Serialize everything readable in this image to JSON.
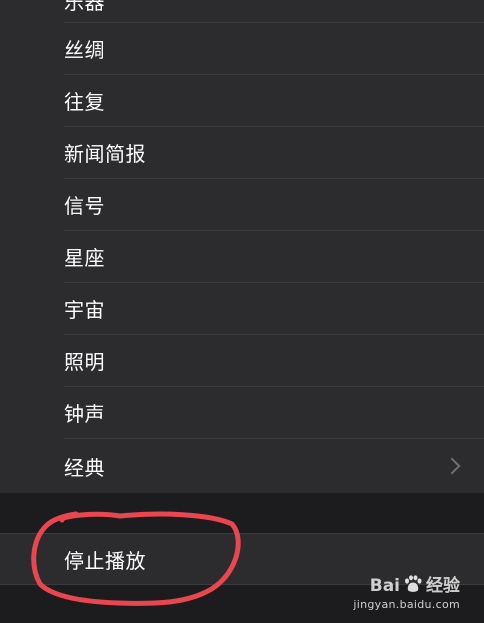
{
  "menu": {
    "items": [
      {
        "label": "乐器"
      },
      {
        "label": "丝绸"
      },
      {
        "label": "往复"
      },
      {
        "label": "新闻简报"
      },
      {
        "label": "信号"
      },
      {
        "label": "星座"
      },
      {
        "label": "宇宙"
      },
      {
        "label": "照明"
      },
      {
        "label": "钟声"
      },
      {
        "label": "经典",
        "icon": "chevron-right-icon"
      }
    ]
  },
  "stop_button": {
    "label": "停止播放"
  },
  "annotation": {
    "color": "#e8474f",
    "shape": "hand-drawn circle"
  },
  "watermark": {
    "brand_left": "Bai",
    "brand_icon": "baidu-paw-icon",
    "brand_right": "经验",
    "url": "jingyan.baidu.com"
  },
  "colors": {
    "background": "#1c1c1e",
    "row": "#2c2c2e",
    "separator": "#3b3b3e",
    "text": "#ffffff"
  }
}
